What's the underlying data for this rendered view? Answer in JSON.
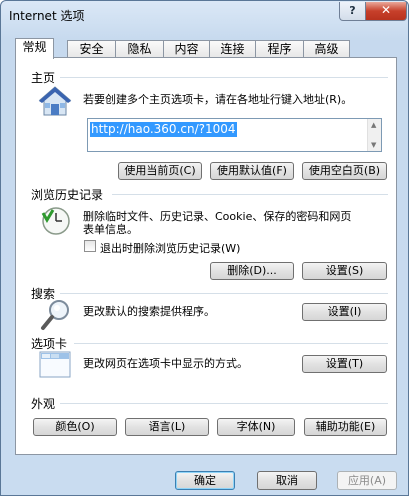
{
  "window": {
    "title": "Internet 选项",
    "help_label": "?",
    "close_label": "✕"
  },
  "tabs": [
    {
      "label": "常规",
      "active": true
    },
    {
      "label": "安全"
    },
    {
      "label": "隐私"
    },
    {
      "label": "内容"
    },
    {
      "label": "连接"
    },
    {
      "label": "程序"
    },
    {
      "label": "高级"
    }
  ],
  "homepage": {
    "title": "主页",
    "description": "若要创建多个主页选项卡，请在各地址行键入地址(R)。",
    "url": "http://hao.360.cn/?1004",
    "use_current": "使用当前页(C)",
    "use_default": "使用默认值(F)",
    "use_blank": "使用空白页(B)",
    "icon": "house-icon"
  },
  "history": {
    "title": "浏览历史记录",
    "description_line1": "删除临时文件、历史记录、Cookie、保存的密码和网页",
    "description_line2": "表单信息。",
    "checkbox_label": "退出时删除浏览历史记录(W)",
    "checkbox_checked": false,
    "delete_button": "删除(D)...",
    "settings_button": "设置(S)",
    "icon": "history-clock-icon"
  },
  "search": {
    "title": "搜索",
    "description": "更改默认的搜索提供程序。",
    "settings_button": "设置(I)",
    "icon": "magnifier-icon"
  },
  "tabs_section": {
    "title": "选项卡",
    "description": "更改网页在选项卡中显示的方式。",
    "settings_button": "设置(T)",
    "icon": "tabbed-window-icon"
  },
  "appearance": {
    "title": "外观",
    "colors_button": "颜色(O)",
    "languages_button": "语言(L)",
    "fonts_button": "字体(N)",
    "accessibility_button": "辅助功能(E)"
  },
  "footer": {
    "ok": "确定",
    "cancel": "取消",
    "apply": "应用(A)"
  }
}
